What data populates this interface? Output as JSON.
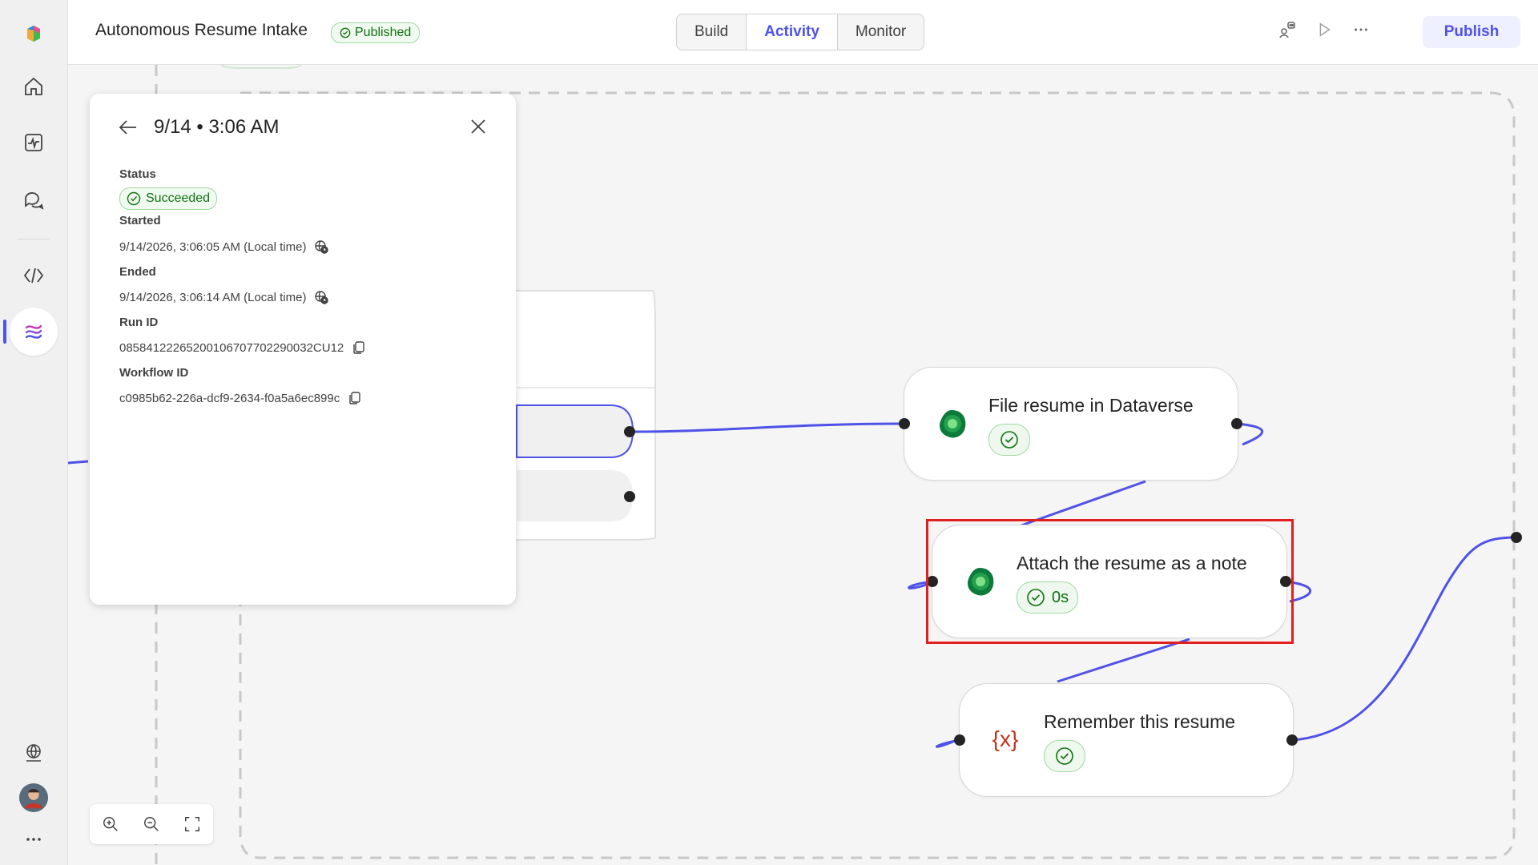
{
  "app": {
    "title": "Autonomous Resume Intake",
    "status_badge": "Published"
  },
  "tabs": [
    {
      "label": "Build",
      "active": false
    },
    {
      "label": "Activity",
      "active": true
    },
    {
      "label": "Monitor",
      "active": false
    }
  ],
  "toolbar": {
    "publish_label": "Publish",
    "icons": [
      "agent-share-icon",
      "play-icon",
      "more-icon"
    ]
  },
  "rail": {
    "icons": [
      "copilot-logo-icon",
      "home-icon",
      "activity-icon",
      "chat-icon",
      "code-icon",
      "flows-icon",
      "globe-icon",
      "avatar",
      "more-icon"
    ],
    "active": "flows-icon"
  },
  "run_panel": {
    "title": "9/14 • 3:06 AM",
    "status_label": "Status",
    "status_value": "Succeeded",
    "started_label": "Started",
    "started_value": "9/14/2026, 3:06:05 AM (Local time)",
    "ended_label": "Ended",
    "ended_value": "9/14/2026, 3:06:14 AM (Local time)",
    "run_id_label": "Run ID",
    "run_id_value": "08584122265200106707702290032CU12",
    "workflow_id_label": "Workflow ID",
    "workflow_id_value": "c0985b62-226a-dcf9-2634-f0a5a6ec899c"
  },
  "nodes": [
    {
      "title": "File resume in Dataverse",
      "icon": "dataverse-icon",
      "status": ""
    },
    {
      "title": "Attach the resume as a note",
      "icon": "dataverse-icon",
      "status": "0s"
    },
    {
      "title": "Remember this resume",
      "icon": "variable-icon",
      "status": ""
    }
  ],
  "zoom_controls": [
    "zoom-in-icon",
    "zoom-out-icon",
    "fit-screen-icon"
  ],
  "colors": {
    "accent": "#4f52e6",
    "success": "#0e700e",
    "highlight": "#e0201f",
    "connector": "#4f52e6"
  }
}
